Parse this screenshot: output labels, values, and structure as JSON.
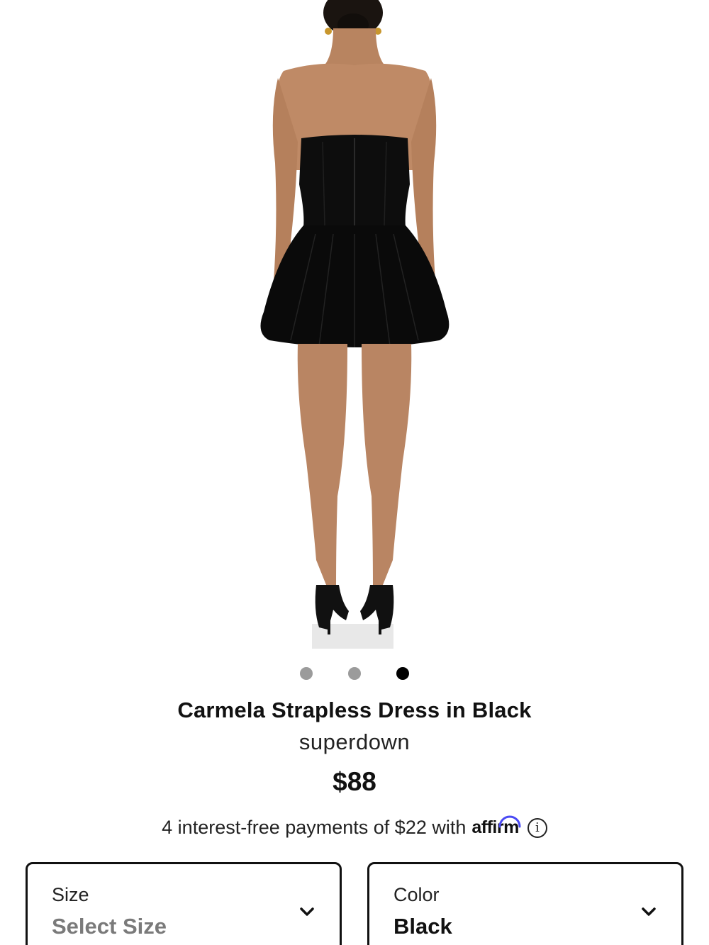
{
  "product": {
    "image_alt": "",
    "carousel": {
      "count": 3,
      "active_index": 2
    },
    "title": "Carmela Strapless Dress in Black",
    "brand": "superdown",
    "price": "$88",
    "installments": {
      "text": "4 interest-free payments of $22 with",
      "provider": "affirm",
      "info_icon": "info-icon"
    }
  },
  "selectors": {
    "size": {
      "label": "Size",
      "value": "Select Size",
      "icon": "chevron-down-icon"
    },
    "color": {
      "label": "Color",
      "value": "Black",
      "icon": "chevron-down-icon"
    }
  },
  "colors": {
    "dot_inactive": "#9b9b9b",
    "dot_active": "#000000",
    "affirm_arc": "#4a4af4"
  }
}
